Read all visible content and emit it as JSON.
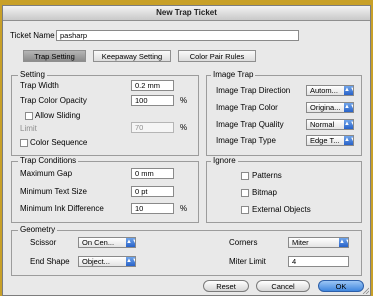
{
  "window": {
    "title": "New Trap Ticket"
  },
  "ticket": {
    "name_label": "Ticket Name",
    "name_value": "pasharp"
  },
  "tabs": [
    {
      "label": "Trap Setting",
      "selected": true
    },
    {
      "label": "Keepaway Setting",
      "selected": false
    },
    {
      "label": "Color Pair Rules",
      "selected": false
    }
  ],
  "setting": {
    "title": "Setting",
    "trap_width_label": "Trap Width",
    "trap_width_value": "0.2 mm",
    "trap_color_opacity_label": "Trap Color Opacity",
    "trap_color_opacity_value": "100",
    "trap_color_opacity_unit": "%",
    "allow_sliding_label": "Allow Sliding",
    "limit_label": "Limit",
    "limit_value": "70",
    "limit_unit": "%",
    "color_sequence_label": "Color Sequence"
  },
  "image_trap": {
    "title": "Image Trap",
    "direction_label": "Image Trap Direction",
    "direction_value": "Autom...",
    "color_label": "Image Trap Color",
    "color_value": "Origina...",
    "quality_label": "Image Trap Quality",
    "quality_value": "Normal",
    "type_label": "Image Trap Type",
    "type_value": "Edge T..."
  },
  "trap_conditions": {
    "title": "Trap Conditions",
    "max_gap_label": "Maximum Gap",
    "max_gap_value": "0 mm",
    "min_text_label": "Minimum Text Size",
    "min_text_value": "0 pt",
    "min_ink_label": "Minimum Ink Difference",
    "min_ink_value": "10",
    "min_ink_unit": "%"
  },
  "ignore": {
    "title": "Ignore",
    "patterns_label": "Patterns",
    "bitmap_label": "Bitmap",
    "external_label": "External Objects"
  },
  "geometry": {
    "title": "Geometry",
    "scissor_label": "Scissor",
    "scissor_value": "On Cen...",
    "end_shape_label": "End Shape",
    "end_shape_value": "Object...",
    "corners_label": "Corners",
    "corners_value": "Miter",
    "miter_limit_label": "Miter Limit",
    "miter_limit_value": "4"
  },
  "buttons": {
    "reset": "Reset",
    "cancel": "Cancel",
    "ok": "OK"
  }
}
